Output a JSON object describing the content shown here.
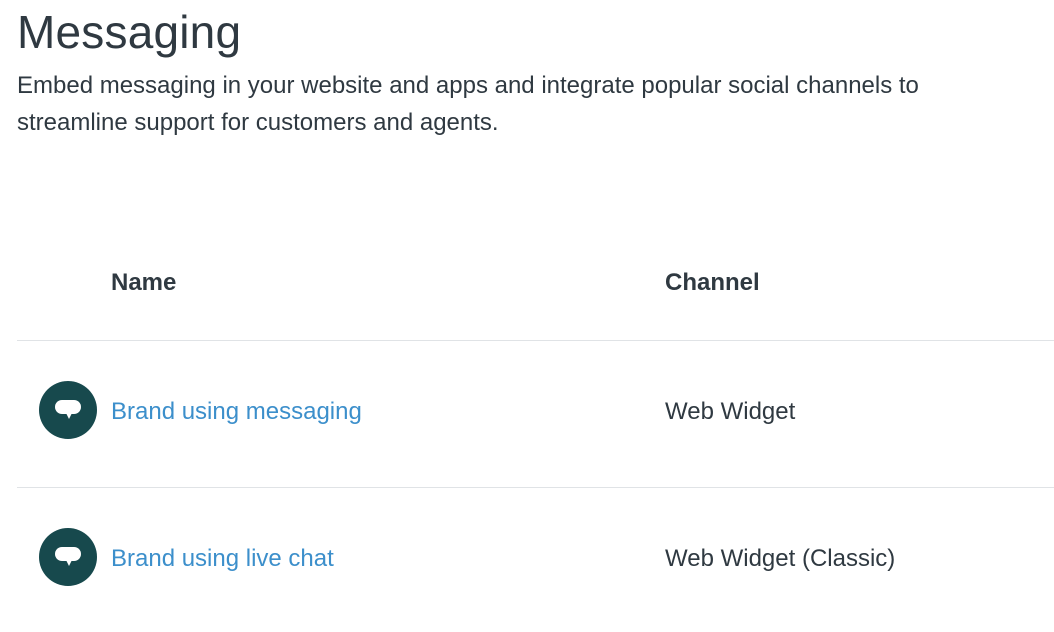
{
  "header": {
    "title": "Messaging",
    "description": "Embed messaging in your website and apps and integrate popular social channels to streamline support for customers and agents."
  },
  "table": {
    "columns": {
      "name": "Name",
      "channel": "Channel"
    },
    "rows": [
      {
        "name": "Brand using messaging",
        "channel": "Web Widget",
        "icon": "chat-bubble-icon"
      },
      {
        "name": "Brand using live chat",
        "channel": "Web Widget (Classic)",
        "icon": "chat-bubble-icon"
      }
    ]
  },
  "colors": {
    "text": "#2f3941",
    "link": "#3c8fcb",
    "icon_bg": "#17494d",
    "divider": "#e0e3e6"
  }
}
